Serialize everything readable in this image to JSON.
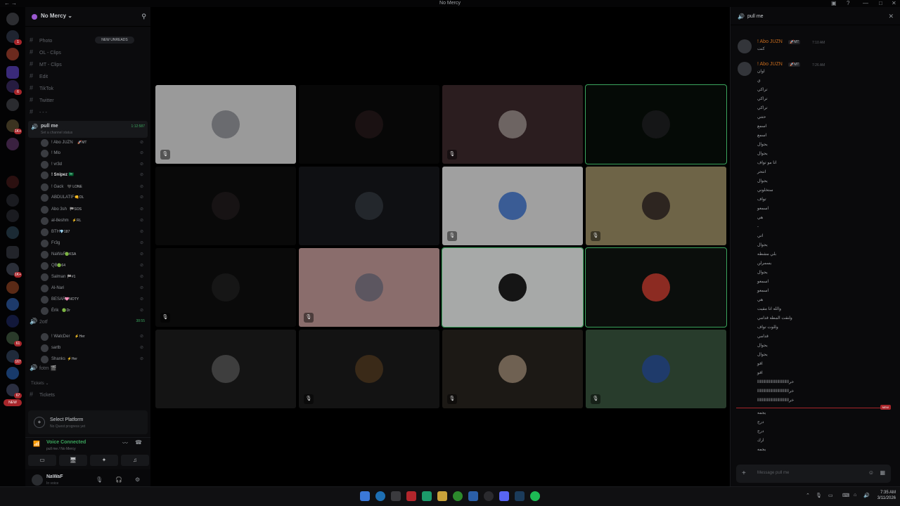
{
  "window": {
    "title": "No Mercy"
  },
  "server": {
    "name": "No Mercy"
  },
  "badges": {
    "new_unreads": "NEW UNREADS",
    "new": "NEW"
  },
  "channels": [
    {
      "name": "Photo",
      "icon": "hash"
    },
    {
      "name": "OL - Clips",
      "icon": "hash"
    },
    {
      "name": "MT - Clips",
      "icon": "hash"
    },
    {
      "name": "Edit",
      "icon": "hash"
    },
    {
      "name": "TikTok",
      "icon": "hash"
    },
    {
      "name": "Twitter",
      "icon": "hash"
    },
    {
      "name": "- - -",
      "icon": "hash"
    }
  ],
  "voice_channel": {
    "name": "pull me",
    "status": "Set a channel status",
    "time": "1:12:587"
  },
  "members": [
    {
      "name": "! Abo JUZN",
      "tag": "🚀MT",
      "bold": false
    },
    {
      "name": "! Mlo",
      "tag": "",
      "bold": false
    },
    {
      "name": "! vr3d",
      "tag": "",
      "bold": false
    },
    {
      "name": "! Snipez 🇸🇦",
      "tag": "",
      "bold": true
    },
    {
      "name": "! Gack",
      "tag": "🖤 LONE",
      "bold": false
    },
    {
      "name": "ABDULATIF",
      "tag": "👊OL",
      "bold": false
    },
    {
      "name": "Abo 3sh",
      "tag": "🏁SOS",
      "bold": false
    },
    {
      "name": "al-8eshm",
      "tag": "⚡RL",
      "bold": false
    },
    {
      "name": "BTH",
      "tag": "💎187",
      "bold": false
    },
    {
      "name": "Fr3g",
      "tag": "",
      "bold": false
    },
    {
      "name": "NaWaF",
      "tag": "🟢KSA",
      "bold": false
    },
    {
      "name": "QB",
      "tag": "🟢64",
      "bold": false
    },
    {
      "name": "Salman",
      "tag": "🏁#1",
      "bold": false
    },
    {
      "name": "Al-Nari",
      "tag": "",
      "bold": false
    },
    {
      "name": "BESAR",
      "tag": "🩷NOTY",
      "bold": false
    },
    {
      "name": "Ёrik",
      "tag": "🟢Dr",
      "bold": false
    }
  ],
  "voice_channel_2": {
    "name": "2otf",
    "time": "38:55"
  },
  "members_2": [
    {
      "name": "! WatcDer",
      "tag": "⚡Her"
    },
    {
      "name": "sartb",
      "tag": ""
    },
    {
      "name": "Shanks",
      "tag": "⚡Her"
    }
  ],
  "voice_channel_3": {
    "name": "fotm 🎬"
  },
  "category": {
    "name": "Tickets",
    "channel": "Tickets"
  },
  "platform": {
    "title": "Select Platform",
    "subtitle": "No Quest progress yet"
  },
  "voice_status": {
    "title": "Voice Connected",
    "subtitle": "pull me / No Mercy"
  },
  "user": {
    "name": "NaWaF",
    "status": "In voice"
  },
  "stage": {
    "tiles": [
      {
        "bg": "#9a9a9a",
        "av": "#6a6b6f",
        "speaking": false,
        "mic": true
      },
      {
        "bg": "#070707",
        "av": "#1a1112",
        "speaking": false,
        "mic": false
      },
      {
        "bg": "#2b1d1f",
        "av": "#6d6462",
        "speaking": false,
        "mic": true
      },
      {
        "bg": "#050a06",
        "av": "#151617",
        "speaking": true,
        "mic": false
      },
      {
        "bg": "#090909",
        "av": "#171314",
        "speaking": false,
        "mic": false
      },
      {
        "bg": "#0f1013",
        "av": "#23272c",
        "speaking": false,
        "mic": false
      },
      {
        "bg": "#a0a0a0",
        "av": "#3a5c95",
        "speaking": false,
        "mic": true
      },
      {
        "bg": "#6e6447",
        "av": "#2d2520",
        "speaking": false,
        "mic": true
      },
      {
        "bg": "#0a0a0a",
        "av": "#161616",
        "speaking": false,
        "mic": true
      },
      {
        "bg": "#8a6d6c",
        "av": "#5c5660",
        "speaking": false,
        "mic": true
      },
      {
        "bg": "#a7a9a8",
        "av": "#151515",
        "speaking": true,
        "mic": false
      },
      {
        "bg": "#0b0e0c",
        "av": "#8c2b22",
        "speaking": true,
        "mic": false
      },
      {
        "bg": "#141414",
        "av": "#3e3e3e",
        "speaking": false,
        "mic": false
      },
      {
        "bg": "#131313",
        "av": "#3a2a18",
        "speaking": false,
        "mic": true
      },
      {
        "bg": "#1c1915",
        "av": "#6f6152",
        "speaking": false,
        "mic": true
      },
      {
        "bg": "#283c2c",
        "av": "#1f3b6b",
        "speaking": false,
        "mic": true
      }
    ]
  },
  "chat": {
    "title": "pull me",
    "messages": [
      {
        "author": "! Abo JUZN",
        "badge": "🚀MT",
        "time": "7:10 AM",
        "lines": [
          "كنت"
        ]
      },
      {
        "author": "! Abo JUZN",
        "badge": "🚀MT",
        "time": "7:26 AM",
        "lines": [
          "اوان",
          "ي",
          "تراكي",
          "تراكي",
          "تراكي",
          "حتتي",
          "اسمع",
          "اسمع",
          "يجوال",
          "يجوال",
          "انا مو تواف",
          "انتحر",
          "يجوال",
          "ستخلوني",
          "تواف",
          "اسمعو",
          "هي",
          "-",
          "اتي",
          "يجوال",
          "بلي مشطه",
          "يسمرلن",
          "يجوال",
          "اسمعو",
          "اسمعو",
          "هي",
          "والله انا مقيت",
          "ولنقت المطه قدامي",
          "وللوت تواف",
          "قدامي",
          "يجوال",
          "يجوال",
          "اقو",
          "اقو",
          "IIIIIIIIIIIIIIIIIIIIIIIIIIIخر",
          "IIIIIIIIIIIIIIIIIIIIIIIIIIIخر",
          "IIIIIIIIIIIIIIIIIIIIIIIIIIIخر"
        ]
      }
    ],
    "after_new": [
      "يجمه",
      "درج",
      "درج",
      "ارك",
      "يجمه"
    ],
    "input_placeholder": "Message pull me"
  },
  "clock": {
    "time": "7:35 AM",
    "date": "3/11/2026"
  }
}
